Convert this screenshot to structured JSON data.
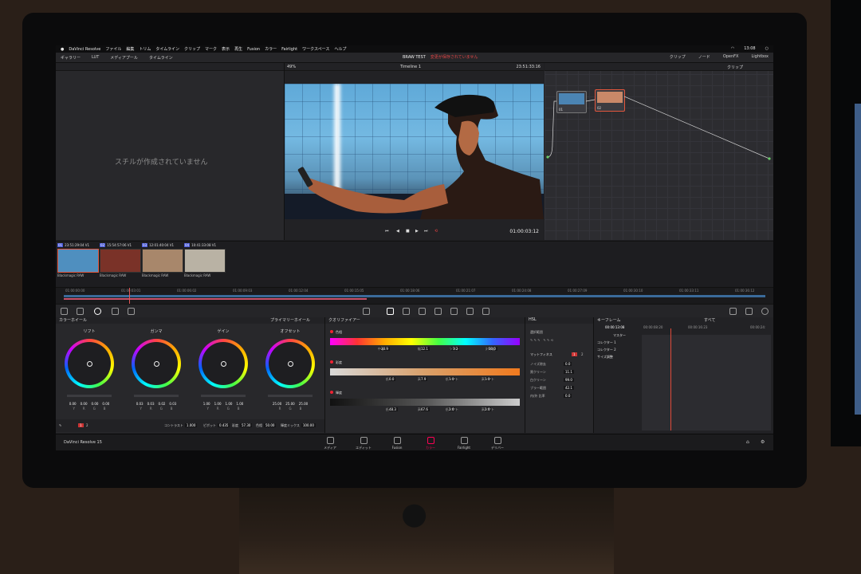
{
  "menubar": {
    "apple": "",
    "items": [
      "DaVinci Resolve",
      "ファイル",
      "編集",
      "トリム",
      "タイムライン",
      "クリップ",
      "マーク",
      "表示",
      "再生",
      "Fusion",
      "カラー",
      "Fairlight",
      "ワークスペース",
      "ヘルプ"
    ],
    "clock": "13:08"
  },
  "toolbar": {
    "gallery": "ギャラリー",
    "lut": "LUT",
    "media_pool": "メディアプール",
    "timeline": "タイムライン",
    "project_name": "BRAW TEST",
    "project_status": "変更が保存されていません",
    "clips": "クリップ",
    "nodes": "ノード",
    "openfx": "OpenFX",
    "lightbox": "Lightbox"
  },
  "gallery": {
    "empty_message": "スチルが作成されていません"
  },
  "viewer": {
    "zoom": "49%",
    "timeline_name": "Timeline 1",
    "source_timecode": "23:51:33:16",
    "timecode": "01:00:03:12"
  },
  "nodes": {
    "clip_dropdown": "クリップ",
    "node1": "01",
    "node2": "02"
  },
  "clips": [
    {
      "num": "01",
      "tc": "23:51:29:04",
      "track": "V1",
      "codec": "Blackmagic RAW"
    },
    {
      "num": "02",
      "tc": "15:54:57:06",
      "track": "V1",
      "codec": "Blackmagic RAW"
    },
    {
      "num": "03",
      "tc": "12:01:40:04",
      "track": "V1",
      "codec": "Blackmagic RAW"
    },
    {
      "num": "04",
      "tc": "10:41:33:08",
      "track": "V1",
      "codec": "Blackmagic RAW"
    }
  ],
  "mini_timeline": {
    "ticks": [
      "01:00:00:00",
      "01:00:03:01",
      "01:00:06:02",
      "01:00:09:03",
      "01:00:12:04",
      "01:00:15:05",
      "01:00:18:06",
      "01:00:21:07",
      "01:00:24:08",
      "01:00:27:09",
      "01:00:30:10",
      "01:00:33:11",
      "01:00:36:12"
    ]
  },
  "wheels": {
    "header": "カラーホイール",
    "mode": "プライマリーホイール",
    "items": [
      {
        "name": "リフト",
        "values": [
          "0.00",
          "0.00",
          "0.00",
          "0.00"
        ]
      },
      {
        "name": "ガンマ",
        "values": [
          "0.03",
          "0.03",
          "0.02",
          "0.03"
        ]
      },
      {
        "name": "ゲイン",
        "values": [
          "1.00",
          "1.00",
          "1.00",
          "1.00"
        ]
      },
      {
        "name": "オフセット",
        "values": [
          "25.00",
          "25.00",
          "25.00"
        ]
      }
    ],
    "channels": [
      "Y",
      "R",
      "G",
      "B"
    ],
    "channels_offset": [
      "R",
      "G",
      "B"
    ],
    "contrast_label": "コントラスト",
    "contrast": "1.000",
    "pivot_label": "ピボット",
    "pivot": "0.435",
    "sat_label": "彩度",
    "sat": "57.30",
    "hue_label": "色相",
    "hue": "50.00",
    "lummix_label": "輝度ミックス",
    "lummix": "100.00",
    "page1": "1",
    "page2": "2"
  },
  "qualifier": {
    "header": "クオリファイアー",
    "mode": "HSL",
    "hue": {
      "title": "色相",
      "center_label": "中心",
      "center": "30.9",
      "width_label": "幅",
      "width": "12.1",
      "soft_label": "ソフト",
      "soft": "3.2",
      "sym_label": "対称度",
      "sym": "50.0"
    },
    "sat": {
      "title": "彩度",
      "low_label": "低",
      "low": "0.0",
      "high_label": "高",
      "high": "7.9",
      "lowsoft_label": "低ソフト",
      "lowsoft": "1.0",
      "highsoft_label": "高ソフト",
      "highsoft": "1.0"
    },
    "lum": {
      "title": "輝度",
      "low_label": "低",
      "low": "48.3",
      "high_label": "高",
      "high": "67.6",
      "lowsoft_label": "低ソフト",
      "lowsoft": "2.6",
      "highsoft_label": "高ソフト",
      "highsoft": "2.6"
    }
  },
  "matte": {
    "select_range": "選択範囲",
    "title": "マットフィネス",
    "page1": "1",
    "page2": "2",
    "rows": [
      {
        "label": "ノイズ除去",
        "value": "0.0"
      },
      {
        "label": "黒クリーン",
        "value": "11.1"
      },
      {
        "label": "白クリーン",
        "value": "99.0"
      },
      {
        "label": "ブラー範囲",
        "value": "42.1"
      },
      {
        "label": "内/外 比率",
        "value": "0.0"
      }
    ]
  },
  "keyframes": {
    "header": "キーフレーム",
    "filter": "すべて",
    "timecode": "00:00:13:08",
    "ticks": [
      "00:00:08:20",
      "00:00:16:23",
      "00:00:24:"
    ],
    "tracks": [
      "マスター",
      "コレクター 1",
      "コレクター 2",
      "サイズ調整"
    ]
  },
  "pagebar": {
    "app": "DaVinci Resolve 15",
    "pages": [
      "メディア",
      "エディット",
      "Fusion",
      "カラー",
      "Fairlight",
      "デリバー"
    ],
    "active": "カラー"
  },
  "colors": {
    "accent": "#f0226a",
    "selection": "#e2563d",
    "playhead": "#e04a3a"
  }
}
